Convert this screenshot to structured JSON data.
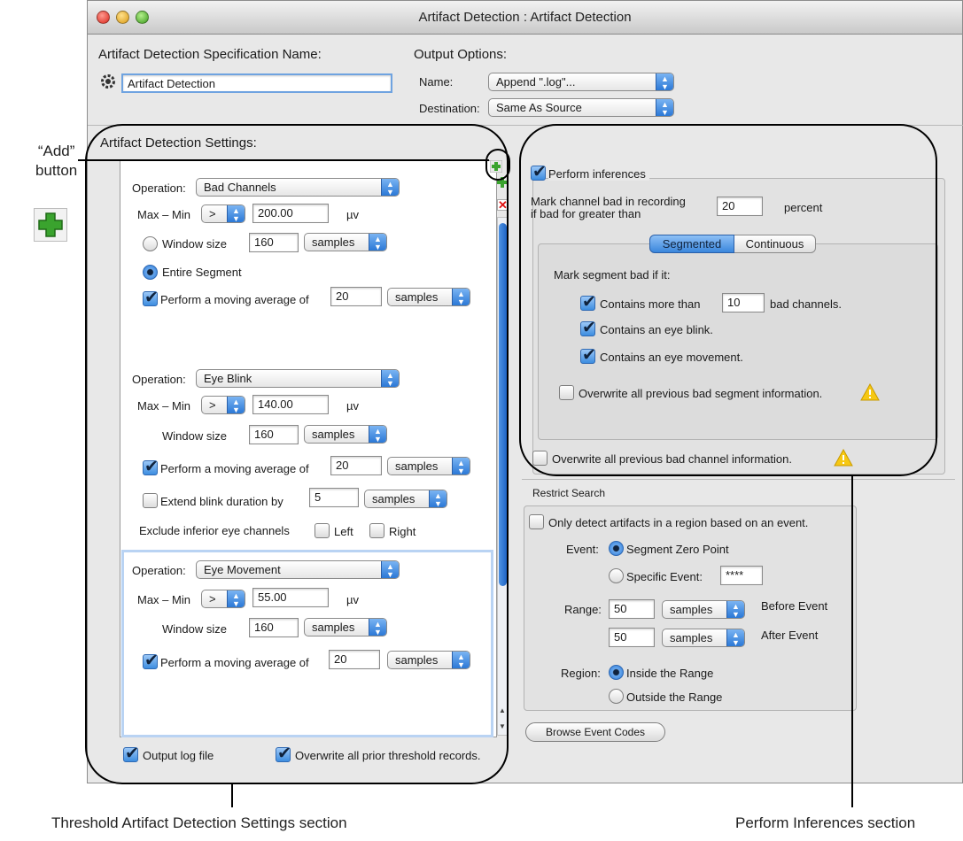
{
  "window": {
    "title": "Artifact Detection : Artifact Detection"
  },
  "spec": {
    "heading": "Artifact Detection Specification Name:",
    "name_value": "Artifact Detection"
  },
  "output_options": {
    "heading": "Output Options:",
    "name_label": "Name:",
    "name_value": "Append \".log\"...",
    "destination_label": "Destination:",
    "destination_value": "Same As Source"
  },
  "settings": {
    "heading": "Artifact Detection Settings:",
    "operation_label": "Operation:",
    "maxmin_label": "Max – Min",
    "comparator": ">",
    "unit": "µv",
    "window_size_label": "Window size",
    "entire_segment_label": "Entire Segment",
    "moving_avg_label": "Perform a moving average of",
    "samples": "samples",
    "op1": {
      "name": "Bad Channels",
      "threshold": "200.00",
      "window": "160",
      "moving_avg": "20"
    },
    "op2": {
      "name": "Eye Blink",
      "threshold": "140.00",
      "window": "160",
      "moving_avg": "20",
      "extend_label": "Extend blink duration by",
      "extend_value": "5",
      "exclude_label": "Exclude inferior eye channels",
      "left_label": "Left",
      "right_label": "Right"
    },
    "op3": {
      "name": "Eye Movement",
      "threshold": "55.00",
      "window": "160",
      "moving_avg": "20"
    },
    "output_log_label": "Output log file",
    "overwrite_prior_label": "Overwrite all prior threshold records."
  },
  "inferences": {
    "perform_label": "Perform inferences",
    "mark_channel_line1": "Mark channel bad in recording",
    "mark_channel_line2": "if bad for greater than",
    "percent_value": "20",
    "percent_label": "percent",
    "tab_segmented": "Segmented",
    "tab_continuous": "Continuous",
    "mark_segment_label": "Mark segment bad if it:",
    "contains_more_label": "Contains more than",
    "bad_channels_value": "10",
    "bad_channels_label": "bad channels.",
    "eye_blink_label": "Contains an eye blink.",
    "eye_movement_label": "Contains an eye movement.",
    "overwrite_segment_label": "Overwrite all previous bad segment information.",
    "overwrite_channel_label": "Overwrite all previous bad channel information."
  },
  "restrict": {
    "heading": "Restrict Search",
    "only_detect_label": "Only detect artifacts in a region based on an event.",
    "event_label": "Event:",
    "segment_zero_label": "Segment Zero Point",
    "specific_event_label": "Specific Event:",
    "specific_event_value": "****",
    "range_label": "Range:",
    "before_value": "50",
    "before_label": "Before Event",
    "after_value": "50",
    "after_label": "After Event",
    "samples": "samples",
    "region_label": "Region:",
    "inside_label": "Inside the Range",
    "outside_label": "Outside the Range",
    "browse_label": "Browse Event Codes"
  },
  "annotations": {
    "add_line1": "“Add”",
    "add_line2": "button",
    "threshold_section": "Threshold Artifact Detection Settings section",
    "inferences_section": "Perform Inferences section"
  },
  "colors": {
    "accent_blue": "#2b78d6",
    "warning_yellow": "#f6c812",
    "add_green": "#3aa32e"
  }
}
